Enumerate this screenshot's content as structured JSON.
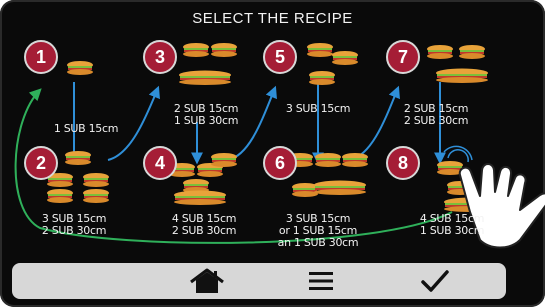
{
  "screen": {
    "title": "SELECT THE RECIPE"
  },
  "recipes": [
    {
      "number": "1",
      "lines": [
        "1 SUB 15cm"
      ]
    },
    {
      "number": "2",
      "lines": [
        "3 SUB 15cm",
        "2 SUB 30cm"
      ]
    },
    {
      "number": "3",
      "lines": [
        "2 SUB 15cm",
        "1 SUB 30cm"
      ]
    },
    {
      "number": "4",
      "lines": [
        "4 SUB 15cm",
        "2 SUB 30cm"
      ]
    },
    {
      "number": "5",
      "lines": [
        "3 SUB 15cm"
      ]
    },
    {
      "number": "6",
      "lines": [
        "3 SUB 15cm",
        "or 1 SUB 15cm",
        "an 1 SUB 30cm"
      ]
    },
    {
      "number": "7",
      "lines": [
        "2 SUB 15cm",
        "2 SUB 30cm"
      ]
    },
    {
      "number": "8",
      "lines": [
        "4 SUB 15cm",
        "1 SUB 30cm"
      ]
    }
  ],
  "nav": {
    "home_icon": "home-icon",
    "menu_icon": "menu-icon",
    "confirm_icon": "checkmark-icon"
  },
  "colors": {
    "badge": "#a51d36",
    "flow_arrow": "#2f8fd8",
    "loop_arrow": "#2fb05a",
    "background": "#0a0a0a",
    "nav_bar": "#d7d7d7"
  }
}
